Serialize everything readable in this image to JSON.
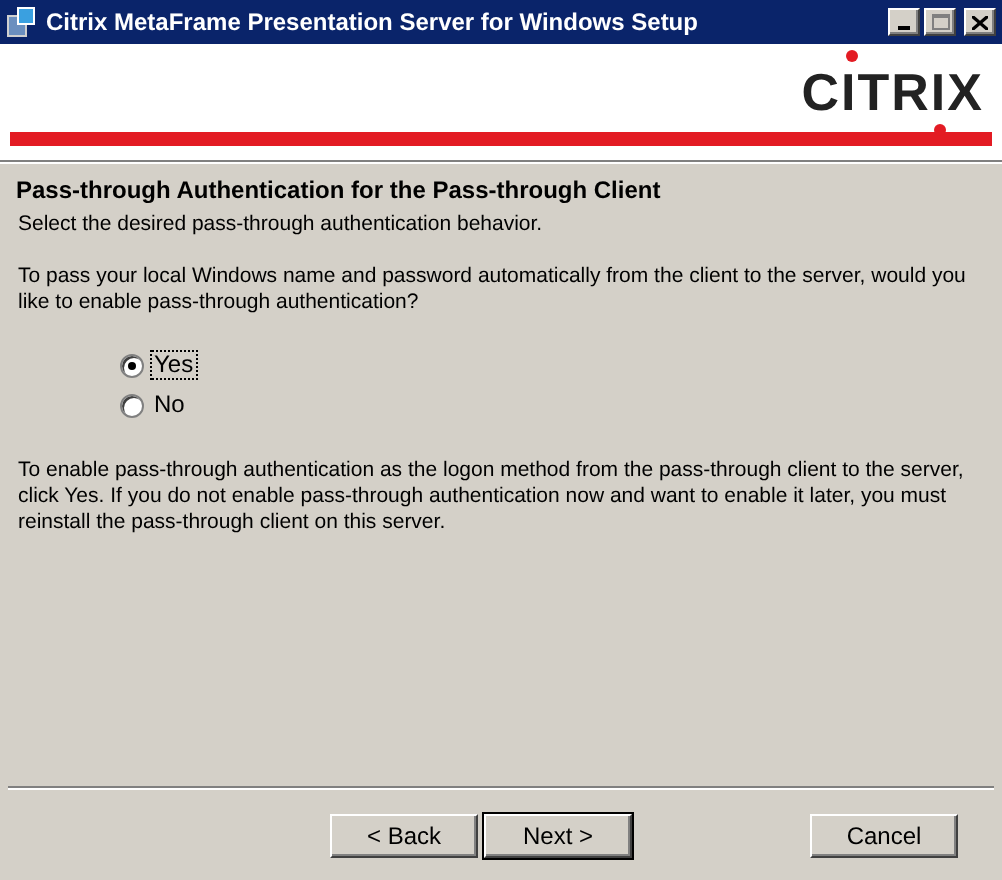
{
  "window": {
    "title": "Citrix MetaFrame Presentation Server for Windows Setup"
  },
  "logo": {
    "text": "CITRIX"
  },
  "heading": "Pass-through Authentication for the Pass-through Client",
  "subheading": "Select the desired pass-through authentication behavior.",
  "question": "To pass your local Windows name and password automatically from the client to the server, would you like to enable pass-through authentication?",
  "options": [
    {
      "label": "Yes",
      "selected": true,
      "focused": true
    },
    {
      "label": "No",
      "selected": false,
      "focused": false
    }
  ],
  "note": "To enable pass-through authentication as the logon method from the pass-through client to the server, click Yes. If you do not enable pass-through authentication now and want to enable it later, you must reinstall the pass-through client on this server.",
  "buttons": [
    {
      "label": "< Back",
      "default": false
    },
    {
      "label": "Next >",
      "default": true
    },
    {
      "label": "Cancel",
      "default": false
    }
  ]
}
